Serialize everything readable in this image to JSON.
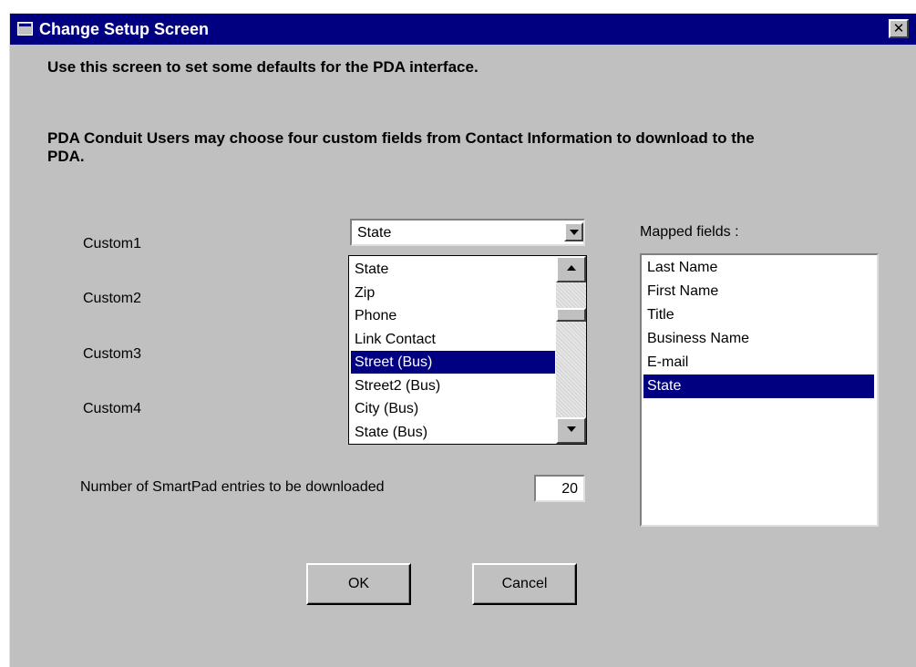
{
  "window": {
    "title": "Change Setup Screen",
    "close_glyph": "✕",
    "icons": {
      "app": "app-window-icon",
      "close": "close-icon"
    },
    "colors": {
      "titlebar": "#000080",
      "face": "#c0c0c0",
      "selection": "#000080"
    }
  },
  "intro_text": "Use this screen to set some defaults for the PDA interface.",
  "conduit_text": "PDA Conduit Users may choose four custom fields from Contact Information to download to the PDA.",
  "custom_fields": {
    "custom1_label": "Custom1",
    "custom2_label": "Custom2",
    "custom3_label": "Custom3",
    "custom4_label": "Custom4"
  },
  "custom1_combo": {
    "value": "State",
    "dropdown_open": true,
    "options_visible": [
      "State",
      "Zip",
      "Phone",
      "Link Contact",
      "Street (Bus)",
      "Street2 (Bus)",
      "City (Bus)",
      "State (Bus)"
    ],
    "highlighted": "Street (Bus)"
  },
  "mapped_fields": {
    "label": "Mapped fields :",
    "items": [
      "Last Name",
      "First Name",
      "Title",
      "Business Name",
      "E-mail",
      "State"
    ],
    "selected": "State"
  },
  "smartpad": {
    "label": "Number of SmartPad entries to be downloaded",
    "value": "20"
  },
  "buttons": {
    "ok": "OK",
    "cancel": "Cancel"
  }
}
